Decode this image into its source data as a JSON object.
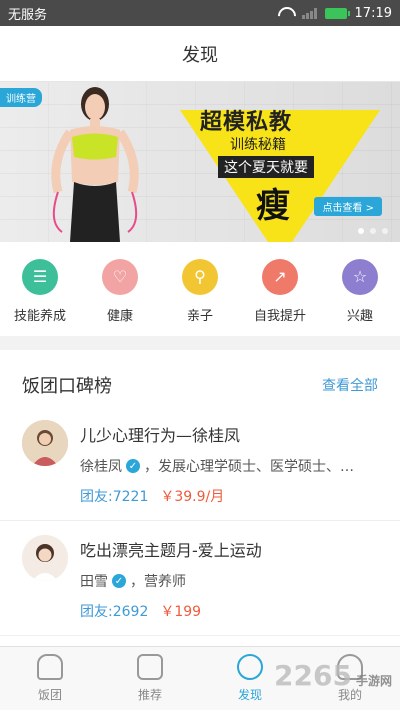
{
  "status": {
    "carrier": "无服务",
    "time": "17:19"
  },
  "header": {
    "title": "发现"
  },
  "banner": {
    "tag": "训练营",
    "line1": "超模私教",
    "line2": "训练秘籍",
    "line3": "这个夏天就要",
    "line4": "瘦",
    "cta": "点击查看 >"
  },
  "categories": [
    {
      "label": "技能养成",
      "icon": "chat-icon",
      "color": "#3dbf9a"
    },
    {
      "label": "健康",
      "icon": "heart-icon",
      "color": "#f2a3a3"
    },
    {
      "label": "亲子",
      "icon": "stroller-icon",
      "color": "#f2c633"
    },
    {
      "label": "自我提升",
      "icon": "growth-icon",
      "color": "#f07a6a"
    },
    {
      "label": "兴趣",
      "icon": "star-icon",
      "color": "#8e7ed0"
    }
  ],
  "ranking": {
    "title": "饭团口碑榜",
    "more": "查看全部",
    "items": [
      {
        "title": "儿少心理行为—徐桂凤",
        "author": "徐桂凤",
        "desc": "，发展心理学硕士、医学硕士、…",
        "members": "团友:7221",
        "price": "￥39.9/月"
      },
      {
        "title": "吃出漂亮主题月-爱上运动",
        "author": "田雪",
        "desc": "，营养师",
        "members": "团友:2692",
        "price": "￥199"
      }
    ]
  },
  "tabs": [
    {
      "label": "饭团",
      "icon": "home-icon"
    },
    {
      "label": "推荐",
      "icon": "list-icon"
    },
    {
      "label": "发现",
      "icon": "compass-icon"
    },
    {
      "label": "我的",
      "icon": "user-icon"
    }
  ],
  "watermark": {
    "brand": "2265",
    "site": "手游网"
  }
}
